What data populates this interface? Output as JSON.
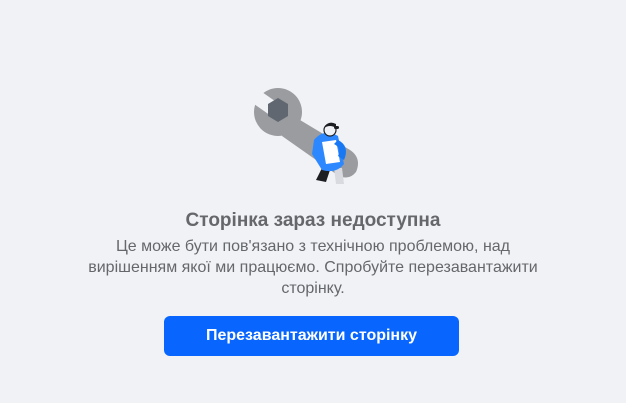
{
  "error": {
    "title": "Сторінка зараз недоступна",
    "message": "Це може бути пов'язано з технічною проблемою, над вирішенням якої ми працюємо. Спробуйте перезавантажити сторінку.",
    "reload_label": "Перезавантажити сторінку",
    "illustration_icon": "wrench-worker-illustration"
  },
  "colors": {
    "background": "#f0f2f5",
    "text": "#65676b",
    "accent": "#0866ff",
    "wrench": "#9a9c9f"
  }
}
